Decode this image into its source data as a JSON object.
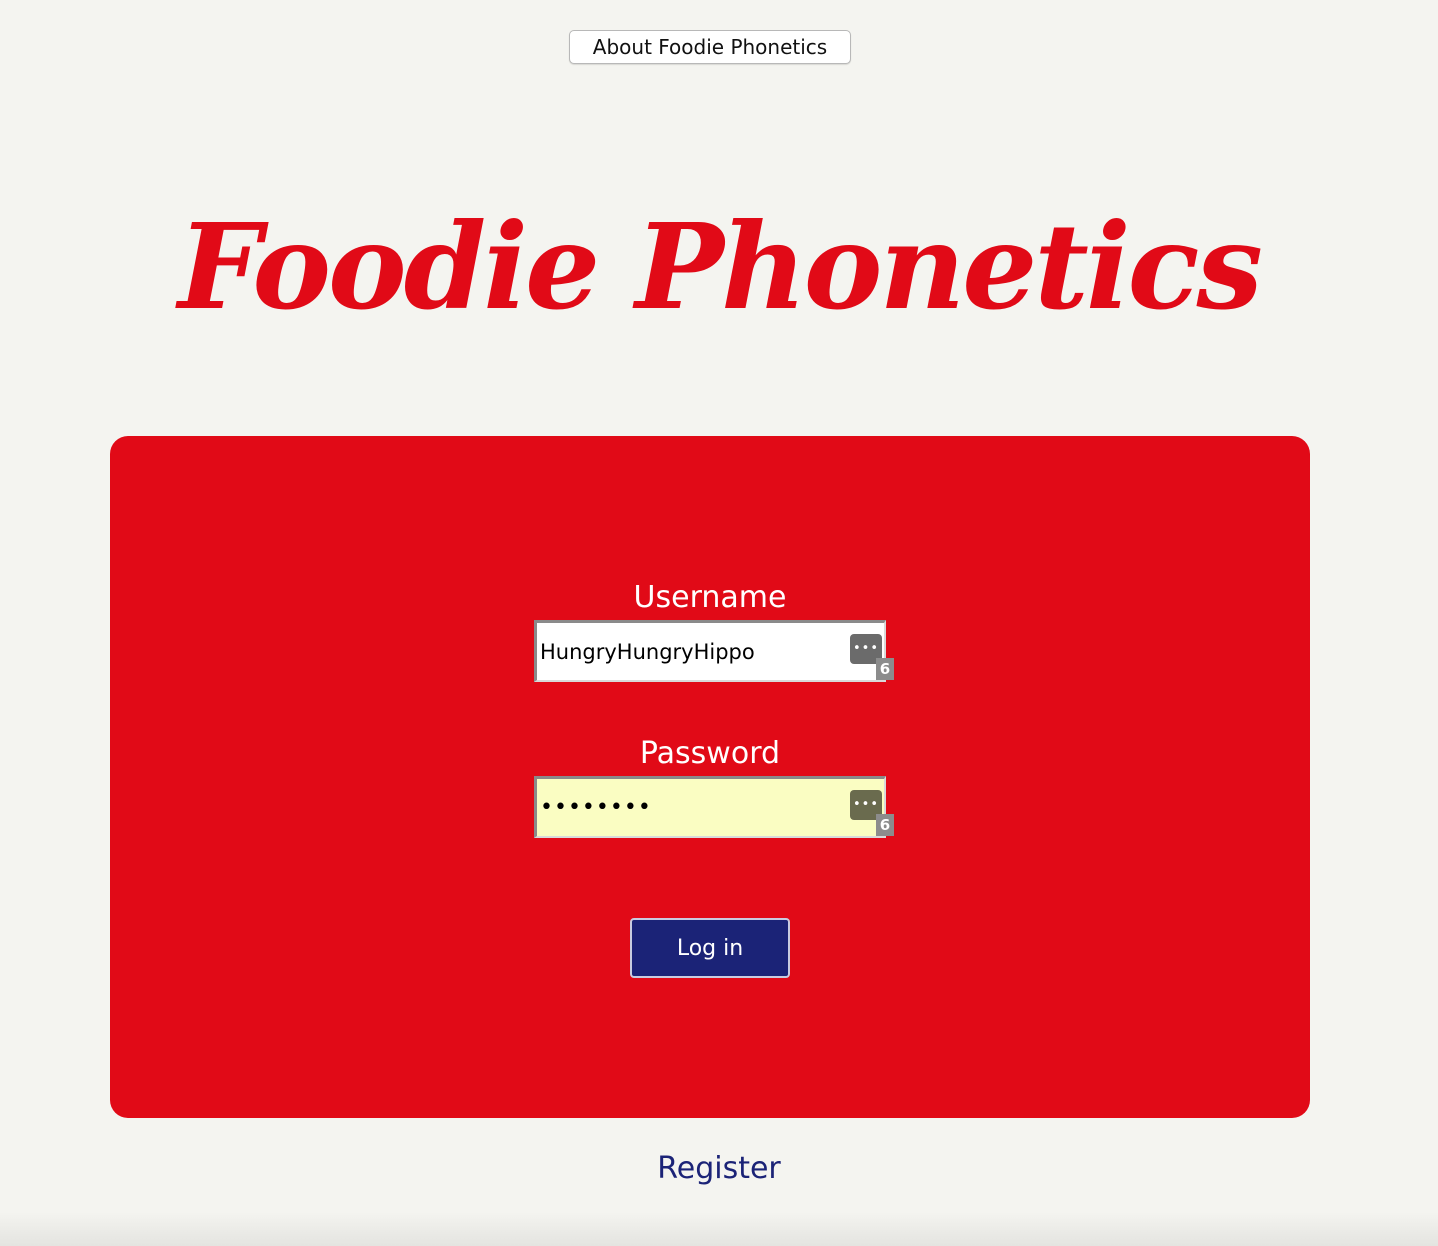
{
  "header": {
    "about_label": "About Foodie Phonetics"
  },
  "brand": {
    "title": "Foodie Phonetics",
    "color": "#e10a17"
  },
  "login_form": {
    "username_label": "Username",
    "username_value": "HungryHungryHippo",
    "password_label": "Password",
    "password_value": "password",
    "password_manager_icon": "password-manager-icon",
    "password_manager_icon_glyph": "•••",
    "password_manager_count": "6",
    "submit_label": "Log in",
    "card_color": "#e10a17",
    "button_color": "#1b2377"
  },
  "footer": {
    "register_label": "Register"
  }
}
